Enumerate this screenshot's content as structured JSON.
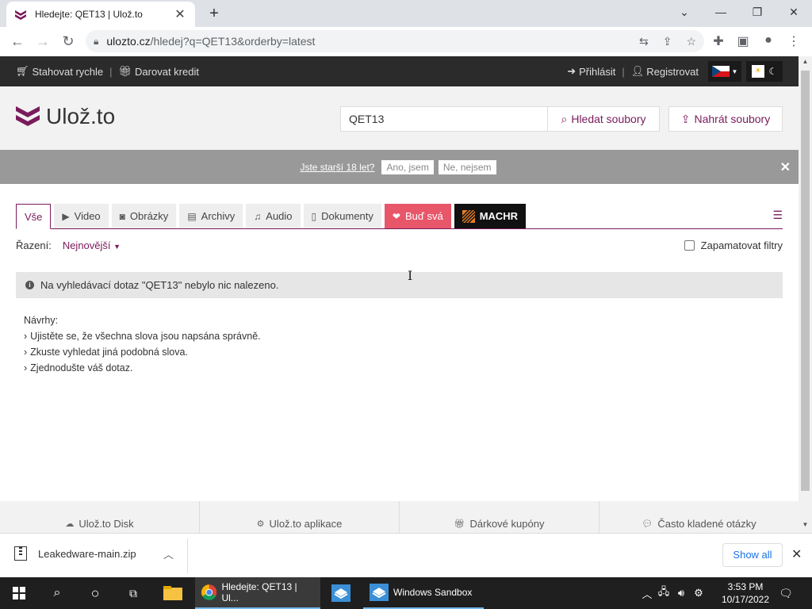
{
  "browser": {
    "tab_title": "Hledejte: QET13 | Ulož.to",
    "url_host": "ulozto.cz",
    "url_path": "/hledej?q=QET13&orderby=latest"
  },
  "topbar": {
    "fast_download": "Stahovat rychle",
    "donate_credit": "Darovat kredit",
    "login": "Přihlásit",
    "register": "Registrovat"
  },
  "header": {
    "logo_text": "Ulož.to",
    "search_value": "QET13",
    "search_button": "Hledat soubory",
    "upload_button": "Nahrát soubory"
  },
  "age_gate": {
    "question": "Jste starší 18 let?",
    "yes": "Ano, jsem",
    "no": "Ne, nejsem"
  },
  "categories": [
    {
      "label": "Vše"
    },
    {
      "label": "Video"
    },
    {
      "label": "Obrázky"
    },
    {
      "label": "Archivy"
    },
    {
      "label": "Audio"
    },
    {
      "label": "Dokumenty"
    },
    {
      "label": "Buď svá"
    },
    {
      "label": "MACHR"
    }
  ],
  "sorting": {
    "label": "Řazení:",
    "value": "Nejnovější",
    "remember_filters": "Zapamatovat filtry"
  },
  "notice": "Na vyhledávací dotaz \"QET13\" nebylo nic nalezeno.",
  "suggestions": {
    "title": "Návrhy:",
    "items": [
      "Ujistěte se, že všechna slova jsou napsána správně.",
      "Zkuste vyhledat jiná podobná slova.",
      "Zjednodušte váš dotaz."
    ]
  },
  "footer": [
    "Ulož.to Disk",
    "Ulož.to aplikace",
    "Dárkové kupóny",
    "Často kladené otázky"
  ],
  "download_bar": {
    "file_name": "Leakedware-main.zip",
    "show_all": "Show all"
  },
  "taskbar": {
    "chrome_task": "Hledejte: QET13 | Ul...",
    "sandbox_task": "Windows Sandbox",
    "time": "3:53 PM",
    "date": "10/17/2022"
  },
  "colors": {
    "brand": "#7a1b5b",
    "pink_tab": "#e8566a"
  }
}
